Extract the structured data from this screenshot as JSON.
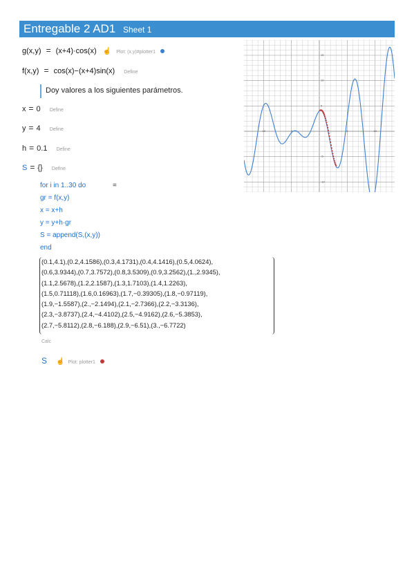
{
  "title": {
    "main": "Entregable 2 AD1",
    "sheet": "Sheet 1"
  },
  "eq_g": {
    "lhs": "g(x,y)",
    "sym": "=",
    "rhs": "(x+4)·cos(x)",
    "action": "Plot: (x,y)#plotter1",
    "dot_color": "#3b7fd0"
  },
  "eq_f": {
    "lhs": "f(x,y)",
    "sym": "=",
    "rhs": "cos(x)−(x+4)sin(x)",
    "action": "Define"
  },
  "note": "Doy valores a los siguientes parámetros.",
  "params": [
    {
      "name": "x",
      "value": "0",
      "action": "Define"
    },
    {
      "name": "y",
      "value": "4",
      "action": "Define"
    },
    {
      "name": "h",
      "value": "0.1",
      "action": "Define"
    },
    {
      "name": "S",
      "value": "{}",
      "action": "Define"
    }
  ],
  "loop": {
    "line1": "for i in 1..30 do",
    "eqsym": "=",
    "line2": "gr = f(x,y)",
    "line3": "x = x+h",
    "line4": "y = y+h·gr",
    "line5": "S = append(S,(x,y))",
    "line6": "end"
  },
  "result_lines": [
    "(0.1,4.1),(0.2,4.1586),(0.3,4.1731),(0.4,4.1416),(0.5,4.0624),",
    "(0.6,3.9344),(0.7,3.7572),(0.8,3.5309),(0.9,3.2562),(1.,2.9345),",
    "(1.1,2.5678),(1.2,2.1587),(1.3,1.7103),(1.4,1.2263),",
    "(1.5,0.71118),(1.6,0.16963),(1.7,−0.39305),(1.8,−0.97119),",
    "(1.9,−1.5587),(2.,−2.1494),(2.1,−2.7366),(2.2,−3.3136),",
    "(2.3,−3.8737),(2.4,−4.4102),(2.5,−4.9162),(2.6,−5.3853),",
    "(2.7,−5.8112),(2.8,−6.188),(2.9,−6.51),(3.,−6.7722)"
  ],
  "calc_label": "Calc",
  "plot_s": {
    "name": "S",
    "action": "Plot: plotter1",
    "dot_color": "#c0393b"
  },
  "chart_data": {
    "type": "line",
    "series": [
      {
        "name": "g(x,y)",
        "color": "#3b7fd0"
      },
      {
        "name": "S",
        "color": "#c0393b",
        "x": [
          0.1,
          0.2,
          0.3,
          0.4,
          0.5,
          0.6,
          0.7,
          0.8,
          0.9,
          1.0,
          1.1,
          1.2,
          1.3,
          1.4,
          1.5,
          1.6,
          1.7,
          1.8,
          1.9,
          2.0,
          2.1,
          2.2,
          2.3,
          2.4,
          2.5,
          2.6,
          2.7,
          2.8,
          2.9,
          3.0
        ],
        "y": [
          4.1,
          4.1586,
          4.1731,
          4.1416,
          4.0624,
          3.9344,
          3.7572,
          3.5309,
          3.2562,
          2.9345,
          2.5678,
          2.1587,
          1.7103,
          1.2263,
          0.71118,
          0.16963,
          -0.39305,
          -0.97119,
          -1.5587,
          -2.1494,
          -2.7366,
          -3.3136,
          -3.8737,
          -4.4102,
          -4.9162,
          -5.3853,
          -5.8112,
          -6.188,
          -6.51,
          -6.7722
        ]
      }
    ],
    "xlim": [
      -13.5,
      13.5
    ],
    "ylim": [
      -12,
      18
    ],
    "grid": true
  }
}
